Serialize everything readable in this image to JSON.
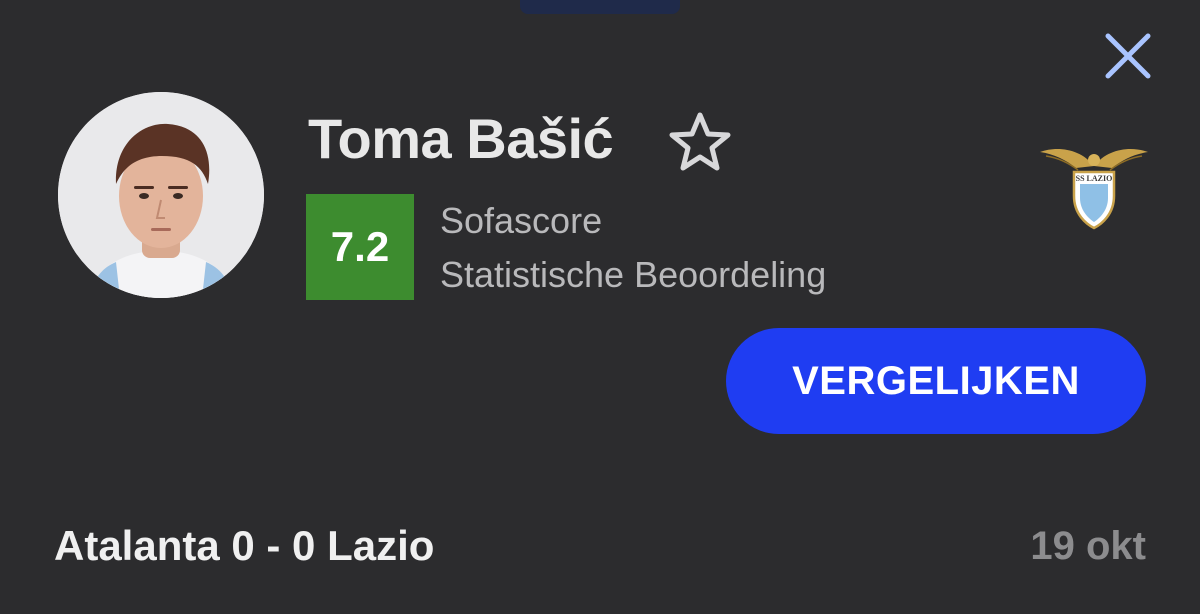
{
  "player": {
    "name": "Toma Bašić",
    "rating": "7.2",
    "rating_source": "Sofascore",
    "rating_type": "Statistische Beoordeling"
  },
  "team": {
    "logo_text": "SS LAZIO",
    "icon": "lazio-crest-icon"
  },
  "actions": {
    "compare_label": "VERGELIJKEN",
    "close_icon": "close-icon",
    "favorite_icon": "star-outline-icon"
  },
  "match": {
    "summary": "Atalanta 0 - 0 Lazio",
    "date": "19 okt"
  },
  "colors": {
    "background": "#2c2c2e",
    "rating_badge": "#3d8c2f",
    "compare_button": "#1f3df2",
    "close_icon": "#a9c4ff"
  }
}
